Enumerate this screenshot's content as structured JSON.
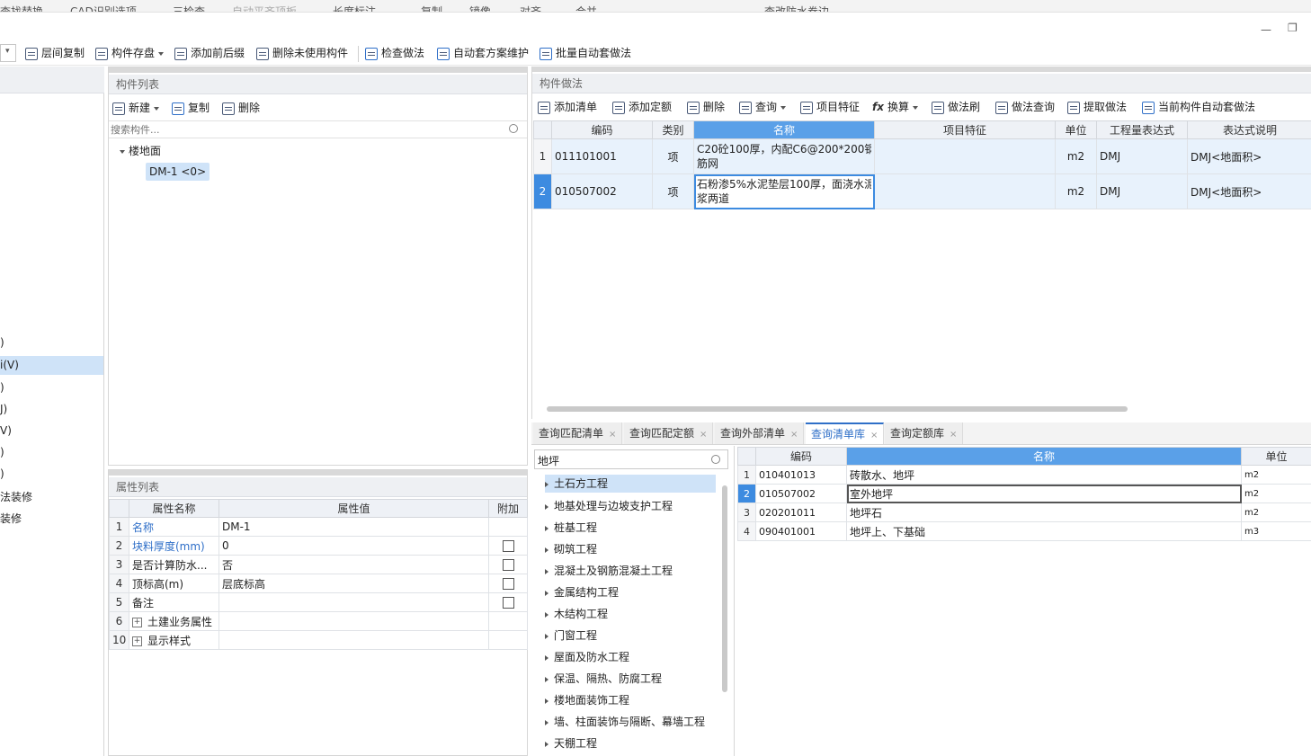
{
  "ribbon_top": {
    "items": [
      "查找替换",
      "CAD识别选项",
      "三检查",
      "自动平齐顶板",
      "长度标注",
      "复制",
      "镜像",
      "对齐",
      "合并",
      "查改防水卷边"
    ]
  },
  "window": {
    "minimize": "—",
    "restore": "❐"
  },
  "toolbar": {
    "dropdown_caret": "▾",
    "items": [
      "层间复制",
      "构件存盘",
      "添加前后缀",
      "删除未使用构件",
      "检查做法",
      "自动套方案维护",
      "批量自动套做法"
    ]
  },
  "left_nav": {
    "items": [
      ")",
      "i(V)",
      ")",
      "J)",
      "V)",
      ")",
      ")",
      "法装修",
      "装修"
    ],
    "selected_index": 1
  },
  "component_list": {
    "title": "构件列表",
    "toolbar": {
      "new": "新建",
      "copy": "复制",
      "delete": "删除"
    },
    "search_placeholder": "搜索构件...",
    "tree": {
      "root": "楼地面",
      "child": "DM-1 <0>"
    }
  },
  "property_list": {
    "title": "属性列表",
    "headers": {
      "name": "属性名称",
      "value": "属性值",
      "extra": "附加"
    },
    "rows": [
      {
        "num": "1",
        "name": "名称",
        "value": "DM-1",
        "checkbox": false,
        "blue": true
      },
      {
        "num": "2",
        "name": "块料厚度(mm)",
        "value": "0",
        "checkbox": true,
        "blue": true
      },
      {
        "num": "3",
        "name": "是否计算防水...",
        "value": "否",
        "checkbox": true,
        "blue": false
      },
      {
        "num": "4",
        "name": "顶标高(m)",
        "value": "层底标高",
        "checkbox": true,
        "blue": false
      },
      {
        "num": "5",
        "name": "备注",
        "value": "",
        "checkbox": true,
        "blue": false
      },
      {
        "num": "6",
        "name": "土建业务属性",
        "value": "",
        "checkbox": false,
        "expand": true
      },
      {
        "num": "10",
        "name": "显示样式",
        "value": "",
        "checkbox": false,
        "expand": true
      }
    ]
  },
  "method_panel": {
    "title": "构件做法",
    "toolbar": [
      "添加清单",
      "添加定额",
      "删除",
      "查询",
      "项目特征",
      "换算",
      "做法刷",
      "做法查询",
      "提取做法",
      "当前构件自动套做法"
    ],
    "headers": [
      "编码",
      "类别",
      "名称",
      "项目特征",
      "单位",
      "工程量表达式",
      "表达式说明"
    ],
    "rows": [
      {
        "num": "1",
        "code": "011101001",
        "type": "项",
        "name_line1": "C20砼100厚，内配C6@200*200钢",
        "name_line2": "筋网",
        "feature": "",
        "unit": "m2",
        "expr": "DMJ",
        "desc": "DMJ<地面积>"
      },
      {
        "num": "2",
        "code": "010507002",
        "type": "项",
        "name_line1": "石粉渗5%水泥垫层100厚，面浇水泥",
        "name_line2": "浆两道",
        "feature": "",
        "unit": "m2",
        "expr": "DMJ",
        "desc": "DMJ<地面积>"
      }
    ]
  },
  "query_tabs": [
    {
      "label": "查询匹配清单",
      "active": false
    },
    {
      "label": "查询匹配定额",
      "active": false
    },
    {
      "label": "查询外部清单",
      "active": false
    },
    {
      "label": "查询清单库",
      "active": true
    },
    {
      "label": "查询定额库",
      "active": false
    }
  ],
  "tab_close": "×",
  "query_search": {
    "value": "地坪"
  },
  "category_tree": [
    "土石方工程",
    "地基处理与边坡支护工程",
    "桩基工程",
    "砌筑工程",
    "混凝土及钢筋混凝土工程",
    "金属结构工程",
    "木结构工程",
    "门窗工程",
    "屋面及防水工程",
    "保温、隔热、防腐工程",
    "楼地面装饰工程",
    "墙、柱面装饰与隔断、幕墙工程",
    "天棚工程"
  ],
  "result_table": {
    "headers": [
      "编码",
      "名称",
      "单位"
    ],
    "rows": [
      {
        "num": "1",
        "code": "010401013",
        "name": "砖散水、地坪",
        "unit": "m2"
      },
      {
        "num": "2",
        "code": "010507002",
        "name": "室外地坪",
        "unit": "m2"
      },
      {
        "num": "3",
        "code": "020201011",
        "name": "地坪石",
        "unit": "m2"
      },
      {
        "num": "4",
        "code": "090401001",
        "name": "地坪上、下基础",
        "unit": "m3"
      }
    ]
  }
}
